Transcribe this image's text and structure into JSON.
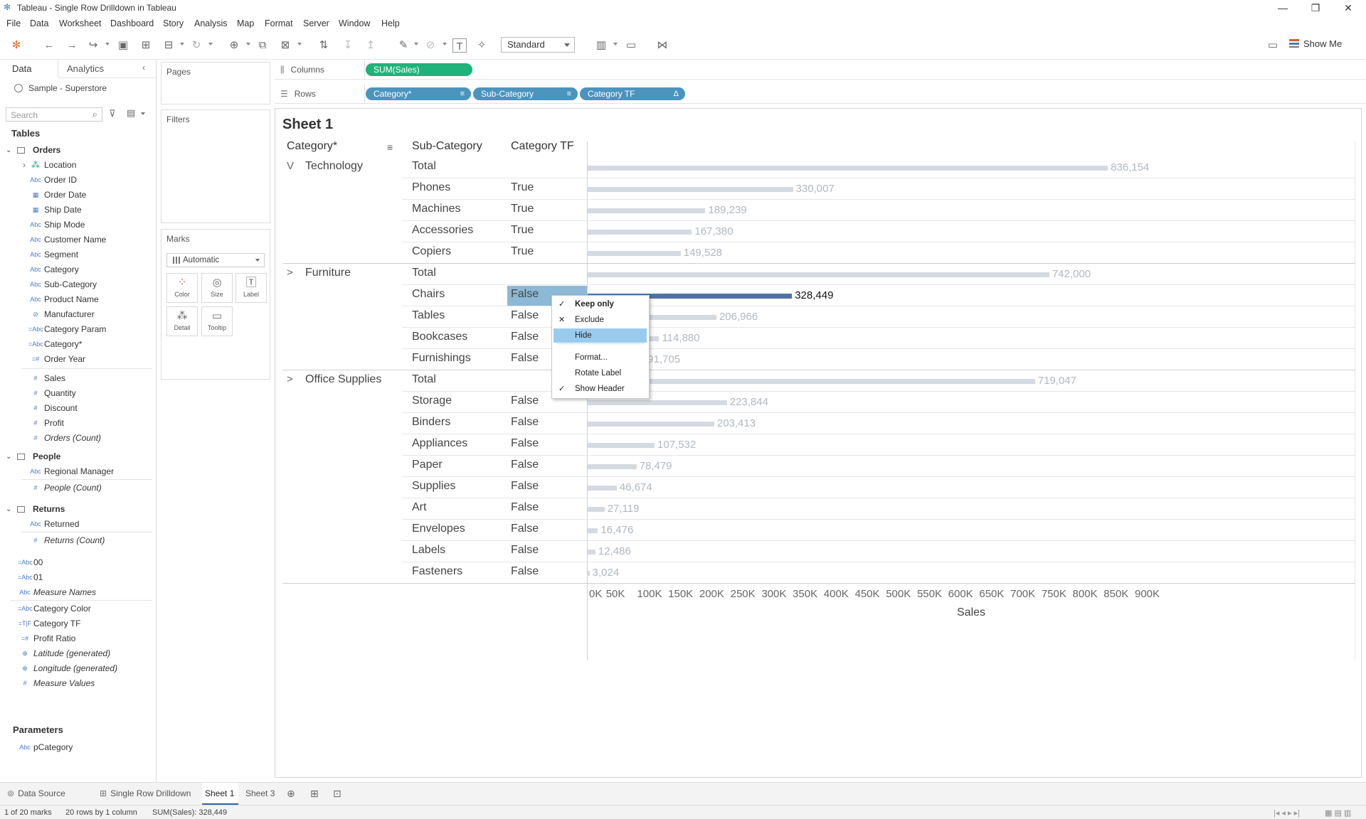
{
  "window": {
    "title": "Tableau - Single Row Drilldown in Tableau"
  },
  "menu": [
    "File",
    "Data",
    "Worksheet",
    "Dashboard",
    "Story",
    "Analysis",
    "Map",
    "Format",
    "Server",
    "Window",
    "Help"
  ],
  "toolbar": {
    "fit": "Standard",
    "show_me": "Show Me"
  },
  "datapane": {
    "tab_data": "Data",
    "tab_analytics": "Analytics",
    "datasource": "Sample - Superstore",
    "search_placeholder": "Search",
    "tables_header": "Tables",
    "groups": {
      "orders": "Orders",
      "people": "People",
      "returns": "Returns"
    },
    "orders_fields": [
      {
        "icon": "›",
        "name": "Location",
        "dim": true
      },
      {
        "icon": "Abc",
        "name": "Order ID"
      },
      {
        "icon": "▦",
        "name": "Order Date"
      },
      {
        "icon": "▦",
        "name": "Ship Date"
      },
      {
        "icon": "Abc",
        "name": "Ship Mode"
      },
      {
        "icon": "Abc",
        "name": "Customer Name"
      },
      {
        "icon": "Abc",
        "name": "Segment"
      },
      {
        "icon": "Abc",
        "name": "Category"
      },
      {
        "icon": "Abc",
        "name": "Sub-Category"
      },
      {
        "icon": "Abc",
        "name": "Product Name"
      },
      {
        "icon": "⊘",
        "name": "Manufacturer"
      },
      {
        "icon": "=Abc",
        "name": "Category Param"
      },
      {
        "icon": "=Abc",
        "name": "Category*"
      },
      {
        "icon": "=#",
        "name": "Order Year"
      }
    ],
    "orders_measures": [
      {
        "icon": "#",
        "name": "Sales"
      },
      {
        "icon": "#",
        "name": "Quantity"
      },
      {
        "icon": "#",
        "name": "Discount"
      },
      {
        "icon": "#",
        "name": "Profit"
      },
      {
        "icon": "#",
        "name": "Orders (Count)",
        "italic": true
      }
    ],
    "people_fields": [
      {
        "icon": "Abc",
        "name": "Regional Manager"
      },
      {
        "icon": "#",
        "name": "People (Count)",
        "italic": true
      }
    ],
    "returns_fields": [
      {
        "icon": "Abc",
        "name": "Returned"
      },
      {
        "icon": "#",
        "name": "Returns (Count)",
        "italic": true
      }
    ],
    "extra_fields": [
      {
        "icon": "=Abc",
        "name": "00"
      },
      {
        "icon": "=Abc",
        "name": "01"
      },
      {
        "icon": "Abc",
        "name": "Measure Names",
        "italic": true
      },
      {
        "icon": "=Abc",
        "name": "Category Color"
      },
      {
        "icon": "=T|F",
        "name": "Category TF"
      },
      {
        "icon": "=#",
        "name": "Profit Ratio"
      },
      {
        "icon": "⊕",
        "name": "Latitude (generated)",
        "italic": true
      },
      {
        "icon": "⊕",
        "name": "Longitude (generated)",
        "italic": true
      },
      {
        "icon": "#",
        "name": "Measure Values",
        "italic": true
      }
    ],
    "parameters_header": "Parameters",
    "parameters": [
      {
        "icon": "Abc",
        "name": "pCategory"
      }
    ]
  },
  "cards": {
    "pages": "Pages",
    "filters": "Filters",
    "marks": "Marks",
    "mark_type": "Automatic",
    "mark_buttons": [
      "Color",
      "Size",
      "Label",
      "Detail",
      "Tooltip"
    ]
  },
  "shelves": {
    "columns_label": "Columns",
    "rows_label": "Rows",
    "columns_pills": [
      {
        "text": "SUM(Sales)",
        "color": "green"
      }
    ],
    "rows_pills": [
      {
        "text": "Category*",
        "icon": "≡"
      },
      {
        "text": "Sub-Category",
        "icon": "≡"
      },
      {
        "text": "Category TF",
        "icon": "Δ"
      }
    ]
  },
  "sheet": {
    "title": "Sheet 1",
    "headers": [
      "Category*",
      "Sub-Category",
      "Category TF"
    ]
  },
  "chart_data": {
    "type": "bar",
    "xlabel": "Sales",
    "xlim": [
      0,
      920000
    ],
    "ticks": [
      "0K",
      "50K",
      "100K",
      "150K",
      "200K",
      "250K",
      "300K",
      "350K",
      "400K",
      "450K",
      "500K",
      "550K",
      "600K",
      "650K",
      "700K",
      "750K",
      "800K",
      "850K",
      "900K"
    ],
    "rows": [
      {
        "category": "Technology",
        "expand": "V",
        "sub": "Total",
        "tf": "",
        "value": 836154,
        "label": "836,154"
      },
      {
        "category": "",
        "sub": "Phones",
        "tf": "True",
        "value": 330007,
        "label": "330,007"
      },
      {
        "category": "",
        "sub": "Machines",
        "tf": "True",
        "value": 189239,
        "label": "189,239"
      },
      {
        "category": "",
        "sub": "Accessories",
        "tf": "True",
        "value": 167380,
        "label": "167,380"
      },
      {
        "category": "",
        "sub": "Copiers",
        "tf": "True",
        "value": 149528,
        "label": "149,528"
      },
      {
        "category": "Furniture",
        "expand": ">",
        "sub": "Total",
        "tf": "",
        "value": 742000,
        "label": "742,000"
      },
      {
        "category": "",
        "sub": "Chairs",
        "tf": "False",
        "value": 328449,
        "label": "328,449",
        "selected": true
      },
      {
        "category": "",
        "sub": "Tables",
        "tf": "False",
        "value": 206966,
        "label": "206,966"
      },
      {
        "category": "",
        "sub": "Bookcases",
        "tf": "False",
        "value": 114880,
        "label": "114,880"
      },
      {
        "category": "",
        "sub": "Furnishings",
        "tf": "False",
        "value": 91705,
        "label": "91,705"
      },
      {
        "category": "Office Supplies",
        "expand": ">",
        "sub": "Total",
        "tf": "",
        "value": 719047,
        "label": "719,047"
      },
      {
        "category": "",
        "sub": "Storage",
        "tf": "False",
        "value": 223844,
        "label": "223,844"
      },
      {
        "category": "",
        "sub": "Binders",
        "tf": "False",
        "value": 203413,
        "label": "203,413"
      },
      {
        "category": "",
        "sub": "Appliances",
        "tf": "False",
        "value": 107532,
        "label": "107,532"
      },
      {
        "category": "",
        "sub": "Paper",
        "tf": "False",
        "value": 78479,
        "label": "78,479"
      },
      {
        "category": "",
        "sub": "Supplies",
        "tf": "False",
        "value": 46674,
        "label": "46,674"
      },
      {
        "category": "",
        "sub": "Art",
        "tf": "False",
        "value": 27119,
        "label": "27,119"
      },
      {
        "category": "",
        "sub": "Envelopes",
        "tf": "False",
        "value": 16476,
        "label": "16,476"
      },
      {
        "category": "",
        "sub": "Labels",
        "tf": "False",
        "value": 12486,
        "label": "12,486"
      },
      {
        "category": "",
        "sub": "Fasteners",
        "tf": "False",
        "value": 3024,
        "label": "3,024"
      }
    ]
  },
  "context_menu": [
    {
      "label": "Keep only",
      "mark": "✓",
      "bold": true
    },
    {
      "label": "Exclude",
      "mark": "✕"
    },
    {
      "label": "Hide",
      "mark": "",
      "highlight": true
    },
    {
      "label": "Format...",
      "mark": ""
    },
    {
      "label": "Rotate Label",
      "mark": ""
    },
    {
      "label": "Show Header",
      "mark": "✓"
    }
  ],
  "sheet_tabs": [
    "Data Source",
    "Single Row Drilldown",
    "Sheet 1",
    "Sheet 3"
  ],
  "status": {
    "marks": "1 of 20 marks",
    "rows": "20 rows by 1 column",
    "sum": "SUM(Sales): 328,449"
  },
  "colors": {
    "bar": "#d4dae1",
    "bar_selected": "#4e72a5",
    "pill_green": "#1fb27a",
    "pill_blue": "#4a94bd",
    "highlight": "#99cbef"
  }
}
